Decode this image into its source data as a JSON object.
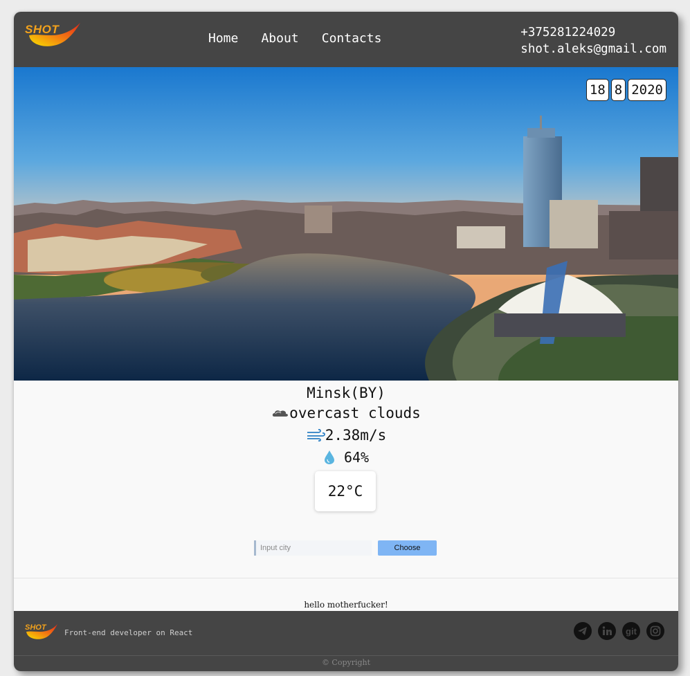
{
  "header": {
    "logo_text": "SHOT",
    "nav": [
      "Home",
      "About",
      "Contacts"
    ],
    "phone": "+375281224029",
    "email": "shot.aleks@gmail.com"
  },
  "date": {
    "day": "18",
    "month": "8",
    "year": "2020"
  },
  "weather": {
    "city": "Minsk(BY)",
    "description": "overcast clouds",
    "wind": "2.38m/s",
    "humidity": "64%",
    "temperature": "22°C"
  },
  "form": {
    "placeholder": "Input city",
    "button": "Choose"
  },
  "greeting": "hello motherfucker!",
  "footer": {
    "logo_text": "SHOT",
    "tagline": "Front-end developer on React",
    "socials": [
      "telegram-icon",
      "linkedin-icon",
      "git-icon",
      "instagram-icon"
    ],
    "git_label": "git",
    "copyright": "© Copyright"
  },
  "colors": {
    "header_bg": "#454545",
    "button": "#7fb5f4",
    "logo": "#f3a21c"
  }
}
